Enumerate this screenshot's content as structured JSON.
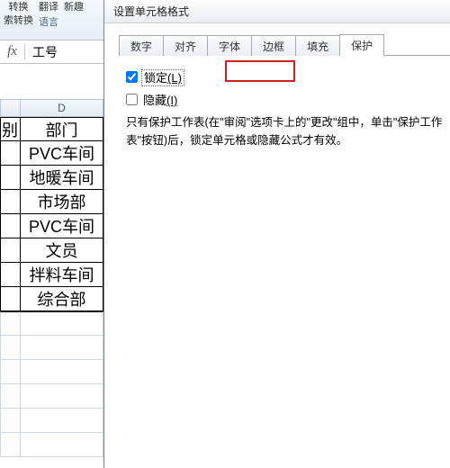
{
  "ribbon": {
    "group1_line1": "转换",
    "group2_line1": "翻译",
    "group3_line1": "新趣",
    "group1_line2": "索转换",
    "group2_label": "语言"
  },
  "formula_bar": {
    "fx": "fx",
    "value": "工号"
  },
  "sheet": {
    "col_headers": {
      "a": "",
      "d": "D"
    },
    "rows": [
      {
        "a": "别",
        "d": "部门"
      },
      {
        "a": "",
        "d": "PVC车间"
      },
      {
        "a": "",
        "d": "地暖车间"
      },
      {
        "a": "",
        "d": "市场部"
      },
      {
        "a": "",
        "d": "PVC车间"
      },
      {
        "a": "",
        "d": "文员"
      },
      {
        "a": "",
        "d": "拌料车间"
      },
      {
        "a": "",
        "d": "综合部"
      }
    ]
  },
  "dialog": {
    "title": "设置单元格格式",
    "tabs": {
      "number": "数字",
      "align": "对齐",
      "font": "字体",
      "border": "边框",
      "fill": "填充",
      "protect": "保护"
    },
    "protect_pane": {
      "lock_label": "锁定",
      "lock_hint": "(L)",
      "hide_label": "隐藏",
      "hide_hint": "(I)",
      "note": "只有保护工作表(在\"审阅\"选项卡上的\"更改\"组中，单击\"保护工作表\"按钮)后，锁定单元格或隐藏公式才有效。"
    }
  }
}
